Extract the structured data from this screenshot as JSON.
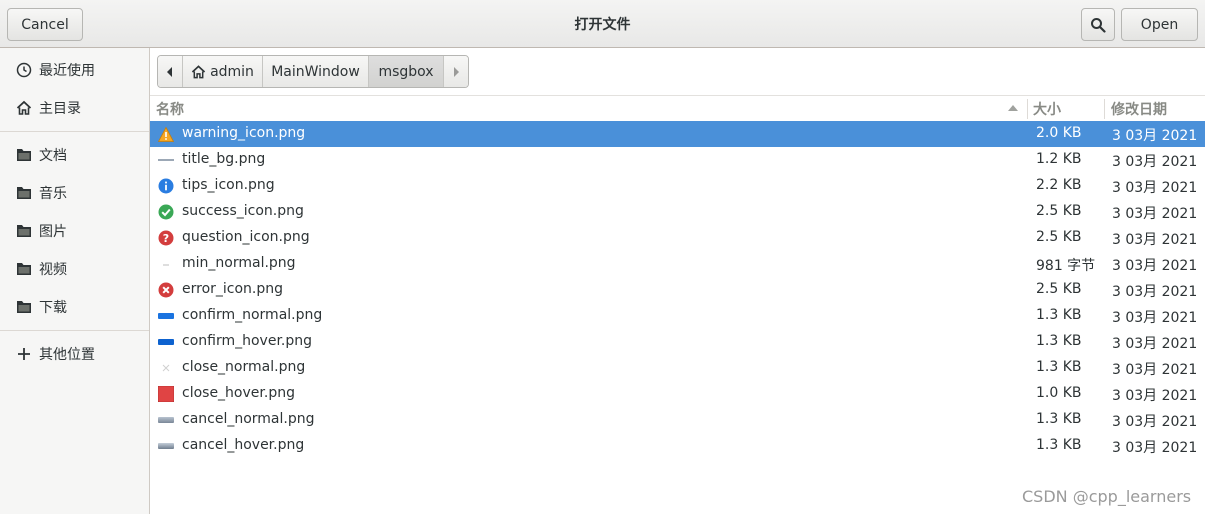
{
  "header": {
    "cancel_label": "Cancel",
    "title": "打开文件",
    "open_label": "Open"
  },
  "sidebar": {
    "items": [
      {
        "label": "最近使用",
        "icon": "clock-icon"
      },
      {
        "label": "主目录",
        "icon": "home-icon"
      },
      {
        "label": "文档",
        "icon": "folder-icon"
      },
      {
        "label": "音乐",
        "icon": "folder-icon"
      },
      {
        "label": "图片",
        "icon": "folder-icon"
      },
      {
        "label": "视频",
        "icon": "folder-icon"
      },
      {
        "label": "下载",
        "icon": "folder-icon"
      },
      {
        "label": "其他位置",
        "icon": "plus-icon"
      }
    ]
  },
  "pathbar": {
    "segments": [
      "admin",
      "MainWindow",
      "msgbox"
    ]
  },
  "columns": {
    "name": "名称",
    "size": "大小",
    "modified": "修改日期"
  },
  "files": [
    {
      "name": "warning_icon.png",
      "size": "2.0 KB",
      "date": "3 03月 2021",
      "icon": "warning-icon",
      "selected": true
    },
    {
      "name": "title_bg.png",
      "size": "1.2 KB",
      "date": "3 03月 2021",
      "icon": "line-thumbnail-icon"
    },
    {
      "name": "tips_icon.png",
      "size": "2.2 KB",
      "date": "3 03月 2021",
      "icon": "info-icon"
    },
    {
      "name": "success_icon.png",
      "size": "2.5 KB",
      "date": "3 03月 2021",
      "icon": "check-circle-icon"
    },
    {
      "name": "question_icon.png",
      "size": "2.5 KB",
      "date": "3 03月 2021",
      "icon": "question-icon"
    },
    {
      "name": "min_normal.png",
      "size": "981 字节",
      "date": "3 03月 2021",
      "icon": "minimize-thumbnail-icon"
    },
    {
      "name": "error_icon.png",
      "size": "2.5 KB",
      "date": "3 03月 2021",
      "icon": "error-icon"
    },
    {
      "name": "confirm_normal.png",
      "size": "1.3 KB",
      "date": "3 03月 2021",
      "icon": "blue-button-thumbnail-icon"
    },
    {
      "name": "confirm_hover.png",
      "size": "1.3 KB",
      "date": "3 03月 2021",
      "icon": "blue-button-thumbnail-icon"
    },
    {
      "name": "close_normal.png",
      "size": "1.3 KB",
      "date": "3 03月 2021",
      "icon": "close-thumbnail-icon"
    },
    {
      "name": "close_hover.png",
      "size": "1.0 KB",
      "date": "3 03月 2021",
      "icon": "red-square-thumbnail-icon"
    },
    {
      "name": "cancel_normal.png",
      "size": "1.3 KB",
      "date": "3 03月 2021",
      "icon": "gray-button-thumbnail-icon"
    },
    {
      "name": "cancel_hover.png",
      "size": "1.3 KB",
      "date": "3 03月 2021",
      "icon": "gray-button-thumbnail-icon"
    }
  ],
  "watermark": "CSDN @cpp_learners",
  "colors": {
    "selection": "#4a90d9",
    "sidebar_bg": "#f6f6f5"
  }
}
